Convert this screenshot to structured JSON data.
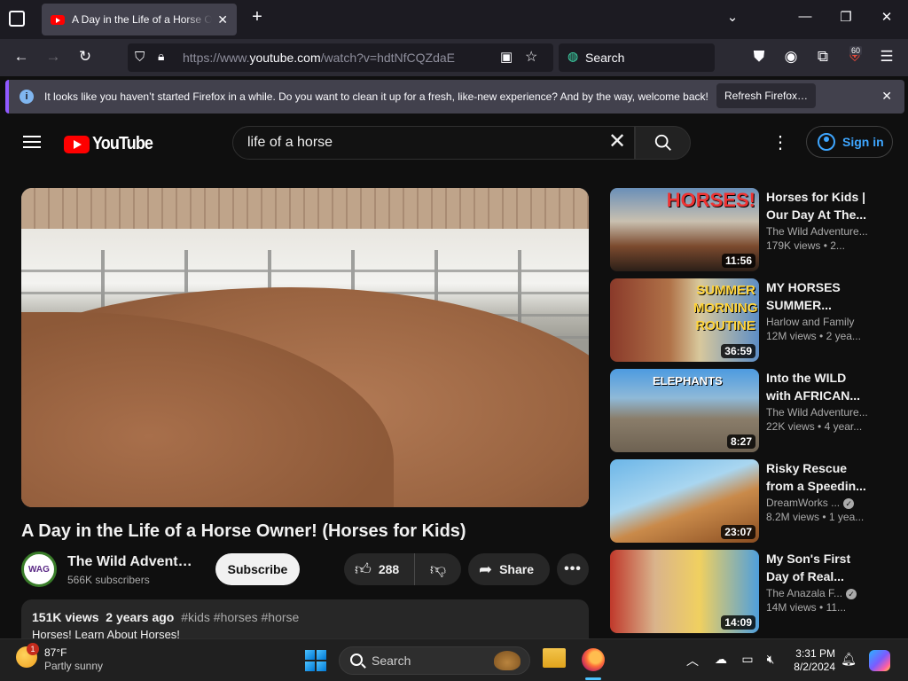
{
  "browser": {
    "tab_title": "A Day in the Life of a Horse Owner! (Horses for Kids) - YouTube",
    "url_prefix": "https://www.",
    "url_domain": "youtube.com",
    "url_path": "/watch?v=hdtNfCQZdaE",
    "search_placeholder": "Search",
    "extension_badge": "60",
    "notice": "It looks like you haven’t started Firefox in a while. Do you want to clean it up for a fresh, like-new experience? And by the way, welcome back!",
    "refresh_label": "Refresh Firefox…"
  },
  "youtube": {
    "logo_text": "YouTube",
    "search_query": "life of a horse",
    "sign_in": "Sign in",
    "video": {
      "title": "A Day in the Life of a Horse Owner! (Horses for Kids)",
      "channel": "The Wild Adventure Girls",
      "channel_avatar_text": "WAG",
      "subscribers": "566K subscribers",
      "subscribe": "Subscribe",
      "likes": "288",
      "share": "Share",
      "views": "151K views",
      "age": "2 years ago",
      "tags": "#kids #horses #horse",
      "desc_line": "Horses!  Learn About Horses!"
    },
    "recommendations": [
      {
        "title": "Horses for Kids | Our Day At The...",
        "channel": "The Wild Adventure...",
        "views": "179K views",
        "age": "2...",
        "duration": "11:56",
        "thumb_text": "HORSES!",
        "verified": false
      },
      {
        "title": "MY HORSES SUMMER...",
        "channel": "Harlow and Family",
        "views": "12M views",
        "age": "2 yea...",
        "duration": "36:59",
        "thumb_text": "SUMMER MORNING ROUTINE",
        "verified": false
      },
      {
        "title": "Into the WILD with AFRICAN...",
        "channel": "The Wild Adventure...",
        "views": "22K views",
        "age": "4 year...",
        "duration": "8:27",
        "thumb_text": "ELEPHANTS",
        "verified": false
      },
      {
        "title": "Risky Rescue from a Speedin...",
        "channel": "DreamWorks ...",
        "views": "8.2M views",
        "age": "1 yea...",
        "duration": "23:07",
        "thumb_text": "",
        "verified": true
      },
      {
        "title": "My Son's First Day of Real...",
        "channel": "The Anazala F...",
        "views": "14M views",
        "age": "11...",
        "duration": "14:09",
        "thumb_text": "",
        "verified": true
      }
    ]
  },
  "taskbar": {
    "temperature": "87°F",
    "condition": "Partly sunny",
    "weather_badge": "1",
    "search": "Search",
    "time": "3:31 PM",
    "date": "8/2/2024"
  },
  "colors": {
    "yt_red": "#ff0000",
    "link_blue": "#3ea6ff",
    "notice_accent": "#9059ff"
  }
}
